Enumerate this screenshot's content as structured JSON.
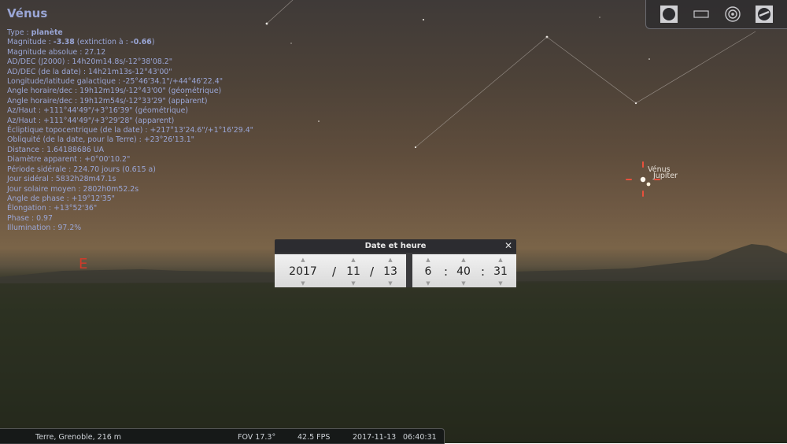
{
  "object": {
    "title": "Vénus",
    "info": [
      {
        "label": "Type : ",
        "value": "planète",
        "bold": true,
        "suffix": ""
      },
      {
        "label": "Magnitude : ",
        "value": "-3.38",
        "bold": true,
        "suffix": " (extinction à : ",
        "value2": "-0.66",
        "suffix2": ")"
      },
      {
        "label": "",
        "value": "Magnitude absolue : 27.12"
      },
      {
        "label": "",
        "value": "AD/DEC (J2000) : 14h20m14.8s/-12°38'08.2\""
      },
      {
        "label": "",
        "value": "AD/DEC (de la date) : 14h21m13s-12°43'00\""
      },
      {
        "label": "",
        "value": "Longitude/latitude galactique : -25°46'34.1\"/+44°46'22.4\""
      },
      {
        "label": "",
        "value": "Angle horaire/dec : 19h12m19s/-12°43'00\" (géométrique)"
      },
      {
        "label": "",
        "value": "Angle horaire/dec : 19h12m54s/-12°33'29\" (apparent)"
      },
      {
        "label": "",
        "value": "Az/Haut : +111°44'49\"/+3°16'39\" (géométrique)"
      },
      {
        "label": "",
        "value": "Az/Haut : +111°44'49\"/+3°29'28\" (apparent)"
      },
      {
        "label": "",
        "value": "Écliptique topocentrique (de la date) : +217°13'24.6\"/+1°16'29.4\""
      },
      {
        "label": "",
        "value": "Obliquité (de la date, pour la Terre) : +23°26'13.1\""
      },
      {
        "label": "",
        "value": "Distance : 1.64188686 UA"
      },
      {
        "label": "",
        "value": "Diamètre apparent : +0°00'10.2\""
      },
      {
        "label": "",
        "value": "Période sidérale : 224.70 jours (0.615 a)"
      },
      {
        "label": "",
        "value": "Jour sidéral : 5832h28m47.1s"
      },
      {
        "label": "",
        "value": "Jour solaire moyen : 2802h0m52.2s"
      },
      {
        "label": "",
        "value": "Angle de phase : +19°12'35\""
      },
      {
        "label": "",
        "value": "Élongation : +13°52'36\""
      },
      {
        "label": "",
        "value": "Phase : 0.97"
      },
      {
        "label": "",
        "value": "Illumination : 97.2%"
      }
    ]
  },
  "sky_labels": {
    "cardinal_east": "E",
    "venus": "Vénus",
    "jupiter": "Jupiter"
  },
  "toolbar": [
    {
      "name": "planet-view-icon"
    },
    {
      "name": "frame-icon"
    },
    {
      "name": "target-icon"
    },
    {
      "name": "telescope-icon"
    }
  ],
  "date_dialog": {
    "title": "Date et heure",
    "close": "✕",
    "year": "2017",
    "month": "11",
    "day": "13",
    "hour": "6",
    "minute": "40",
    "second": "31",
    "date_sep": "/",
    "time_sep": ":",
    "up": "▲",
    "down": "▼"
  },
  "status": {
    "location": "Terre, Grenoble, 216 m",
    "fov": "FOV 17.3°",
    "fps": "42.5 FPS",
    "date": "2017-11-13",
    "time": "06:40:31"
  },
  "colors": {
    "info_text": "#9aa6d6",
    "cardinal": "#d23a2a",
    "marker": "#e8503c"
  }
}
